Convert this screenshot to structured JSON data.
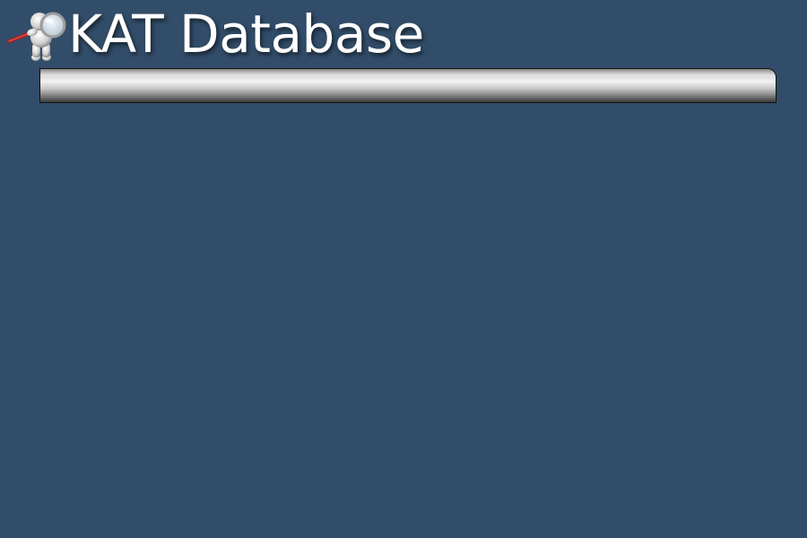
{
  "header": {
    "title": "KAT Database",
    "logo_icon": "magnifier-figure-icon"
  },
  "colors": {
    "background": "#324d69",
    "title_text": "#ffffff"
  }
}
